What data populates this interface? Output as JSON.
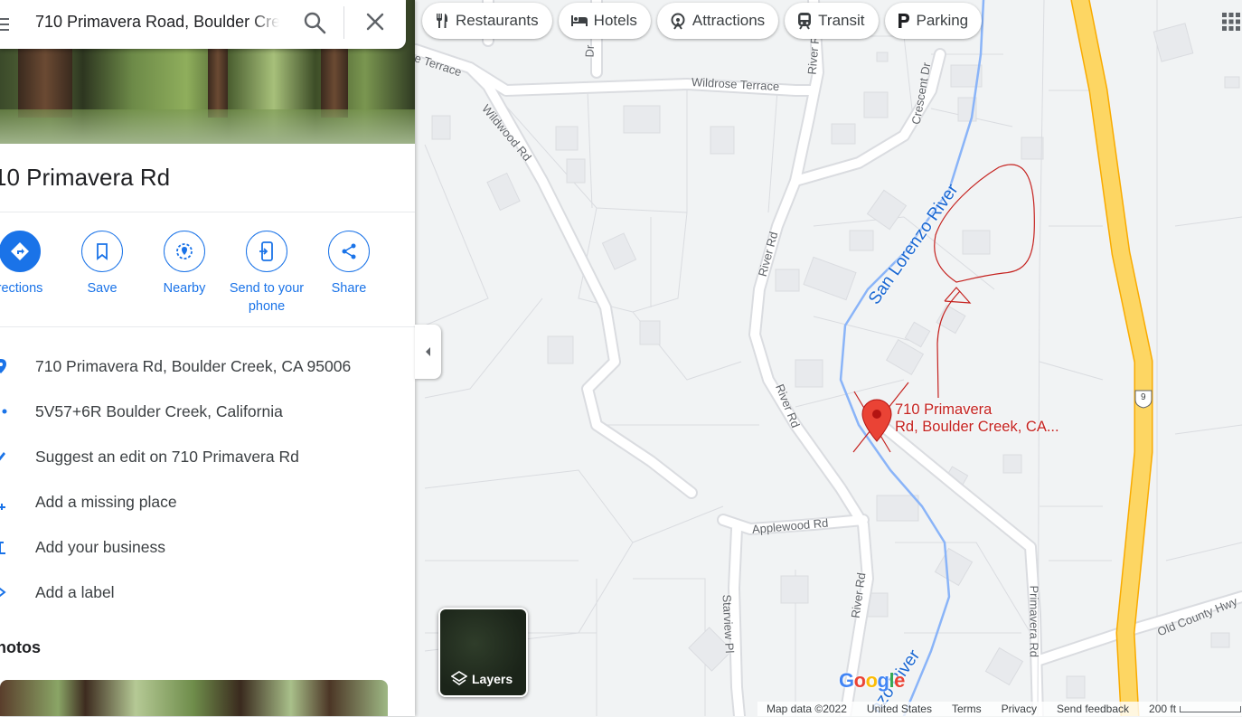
{
  "search": {
    "value": "710 Primavera Road, Boulder Cre",
    "search_icon": "search-icon",
    "close_icon": "close-icon"
  },
  "place": {
    "title": "10 Primavera Rd"
  },
  "actions": [
    {
      "label": "rections",
      "icon": "directions-icon"
    },
    {
      "label": "Save",
      "icon": "bookmark-icon"
    },
    {
      "label": "Nearby",
      "icon": "nearby-icon"
    },
    {
      "label": "Send to your phone",
      "icon": "send-to-phone-icon"
    },
    {
      "label": "Share",
      "icon": "share-icon"
    }
  ],
  "info": [
    {
      "text": "710 Primavera Rd, Boulder Creek, CA 95006",
      "icon": "location-pin-icon"
    },
    {
      "text": "5V57+6R Boulder Creek, California",
      "icon": "plus-code-icon"
    },
    {
      "text": "Suggest an edit on 710 Primavera Rd",
      "icon": "edit-icon"
    },
    {
      "text": "Add a missing place",
      "icon": "add-place-icon"
    },
    {
      "text": "Add your business",
      "icon": "add-business-icon"
    },
    {
      "text": "Add a label",
      "icon": "label-icon"
    }
  ],
  "photos": {
    "title": "hotos"
  },
  "chips": [
    {
      "label": "Restaurants",
      "icon": "restaurant-icon"
    },
    {
      "label": "Hotels",
      "icon": "hotel-icon"
    },
    {
      "label": "Attractions",
      "icon": "attractions-icon"
    },
    {
      "label": "Transit",
      "icon": "transit-icon"
    },
    {
      "label": "Parking",
      "icon": "parking-icon"
    }
  ],
  "map": {
    "roads": {
      "wildrose_terrace": "Wildrose Terrace",
      "terrace": "e Terrace",
      "wildwood": "Wildwood Rd",
      "river_rd_top": "River Rd",
      "river_rd_mid": "River Rd",
      "river_rd_low": "River Rd",
      "river_rd_bottom": "River Rd",
      "crescent": "Crescent Dr",
      "applewood": "Applewood Rd",
      "starview": "Starview Pl",
      "primavera": "Primavera Rd",
      "old_county": "Old County Hwy",
      "dr_top": "Dr"
    },
    "river_label": "San Lorenzo River",
    "river_label_bottom": "nzo River",
    "pin_label_line1": "710 Primavera",
    "pin_label_line2": "Rd, Boulder Creek, CA...",
    "highway_shield": "9",
    "layers_label": "Layers",
    "logo": "Google"
  },
  "footer": {
    "map_data": "Map data ©2022",
    "country": "United States",
    "terms": "Terms",
    "privacy": "Privacy",
    "feedback": "Send feedback",
    "scale": "200 ft"
  },
  "colors": {
    "accent": "#1a73e8",
    "pin": "#ea4335",
    "highway": "#fdd663",
    "river": "#8ab4f8",
    "annotation": "#c5221f"
  }
}
